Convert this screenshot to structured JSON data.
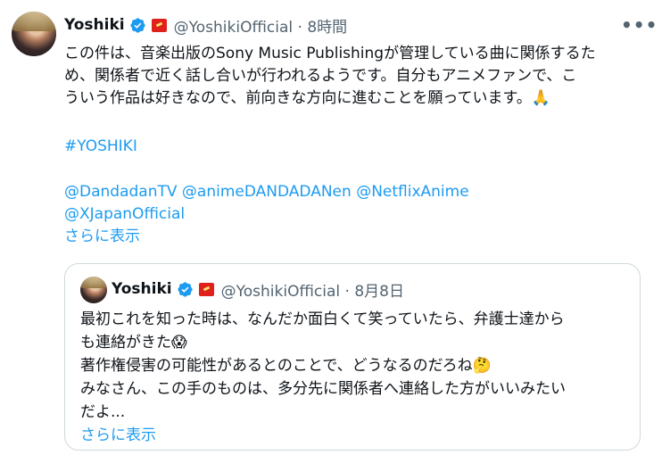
{
  "tweet": {
    "author_name": "Yoshiki",
    "handle_time": "@YoshikiOfficial · 8時間",
    "lines": [
      "この件は、音楽出版のSony Music Publishingが管理している曲に関係するた",
      "め、関係者で近く話し合いが行われるようです。自分もアニメファンで、こ",
      "ういう作品は好きなので、前向きな方向に進むことを願っています。"
    ],
    "emoji_pray": "🙏",
    "hashtag": "#YOSHIKI",
    "mentions_line1": [
      "@DandadanTV",
      "@animeDANDADANen",
      "@NetflixAnime"
    ],
    "mentions_line2": "@XJapanOfficial",
    "show_more": "さらに表示",
    "more_icon": "•••"
  },
  "quoted": {
    "author_name": "Yoshiki",
    "handle_time": "@YoshikiOfficial · 8月8日",
    "line1": "最初これを知った時は、なんだか面白くて笑っていたら、弁護士達から",
    "line2": "も連絡がきた",
    "emoji_scream": "😱",
    "line3": "著作権侵害の可能性があるとのことで、どうなるのだろね",
    "emoji_think": "🤔",
    "line4": "みなさん、この手のものは、多分先に関係者へ連絡した方がいいみたい",
    "line5": "だよ...",
    "show_more": "さらに表示"
  },
  "colors": {
    "link": "#1d9bf0",
    "text": "#0f1419",
    "muted": "#536471",
    "border": "#cfd9de"
  }
}
